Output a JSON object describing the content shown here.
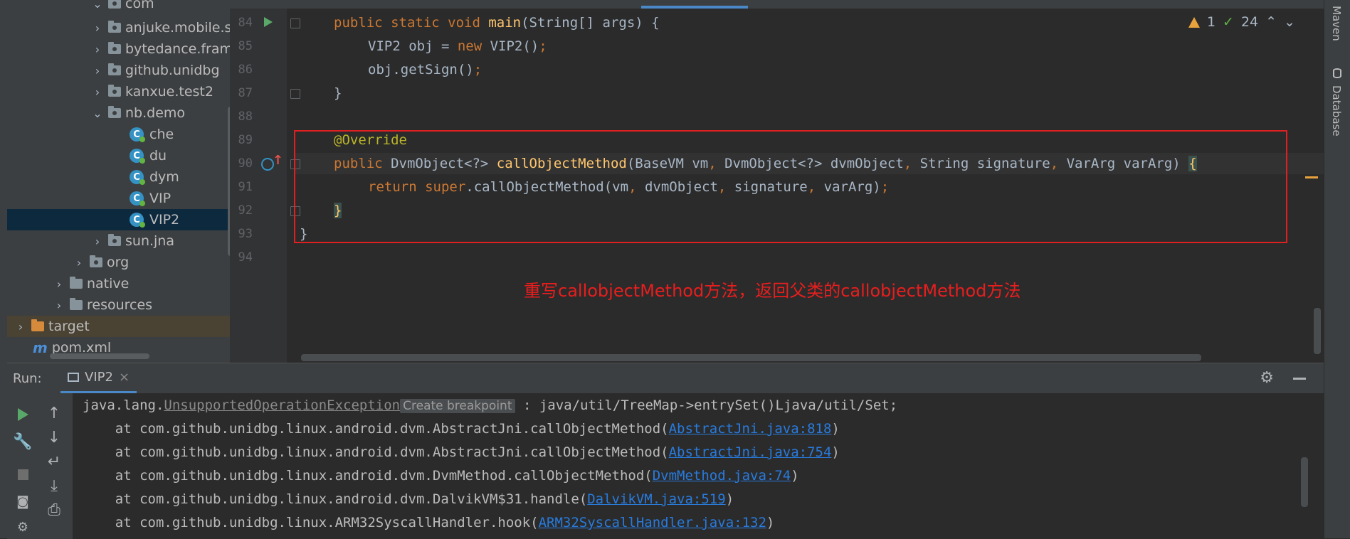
{
  "project_tree": {
    "items": [
      {
        "label": "com",
        "kind": "package"
      },
      {
        "label": "anjuke.mobile.si",
        "kind": "package"
      },
      {
        "label": "bytedance.frame",
        "kind": "package"
      },
      {
        "label": "github.unidbg",
        "kind": "package"
      },
      {
        "label": "kanxue.test2",
        "kind": "package"
      },
      {
        "label": "nb.demo",
        "kind": "package-open"
      },
      {
        "label": "che",
        "kind": "class"
      },
      {
        "label": "du",
        "kind": "class"
      },
      {
        "label": "dym",
        "kind": "class"
      },
      {
        "label": "VIP",
        "kind": "class"
      },
      {
        "label": "VIP2",
        "kind": "class-selected"
      },
      {
        "label": "sun.jna",
        "kind": "package"
      },
      {
        "label": "org",
        "kind": "package"
      },
      {
        "label": "native",
        "kind": "folder"
      },
      {
        "label": "resources",
        "kind": "resources-folder"
      },
      {
        "label": "target",
        "kind": "excluded-folder"
      },
      {
        "label": "pom.xml",
        "kind": "maven-file"
      }
    ]
  },
  "editor": {
    "line_numbers": [
      "84",
      "85",
      "86",
      "87",
      "88",
      "89",
      "90",
      "91",
      "92",
      "93",
      "94"
    ],
    "lines": {
      "l84": {
        "kw1": "public static void ",
        "fn": "main",
        "rest": "(String[] args) {"
      },
      "l85": {
        "a": "VIP2 obj = ",
        "kw": "new ",
        "b": "VIP2()",
        "semi": ";"
      },
      "l86": {
        "a": "obj.getSign()",
        "semi": ";"
      },
      "l87": {
        "a": "}"
      },
      "l89": {
        "ann": "@Override"
      },
      "l90": {
        "kw1": "public ",
        "t1": "DvmObject<?> ",
        "fn": "callObjectMethod",
        "p1": "(BaseVM vm",
        "c1": ", ",
        "p2": "DvmObject<?> dvmObject",
        "c2": ", ",
        "p3": "String signature",
        "c3": ", ",
        "p4": "VarArg varArg) ",
        "brace": "{"
      },
      "l91": {
        "kw1": "return ",
        "kw2": "super",
        "a": ".callObjectMethod(vm",
        "c1": ", ",
        "b": "dvmObject",
        "c2": ", ",
        "c": "signature",
        "c3": ", ",
        "d": "varArg)",
        "semi": ";"
      },
      "l92": {
        "a": "}"
      },
      "l93": {
        "a": "}"
      }
    },
    "inspections": {
      "warnings": "1",
      "weak_warnings": "24"
    },
    "annotation_text": "重写callobjectMethod方法，返回父类的callobjectMethod方法"
  },
  "right_tools": {
    "maven": "Maven",
    "database": "Database"
  },
  "run_panel": {
    "label": "Run:",
    "tab_label": "VIP2",
    "console": {
      "line1": {
        "pre": "java.lang.",
        "exc": "UnsupportedOperationException",
        "hint": "Create breakpoint",
        "post": " : java/util/TreeMap->entrySet()Ljava/util/Set;"
      },
      "frames": [
        {
          "text": "    at com.github.unidbg.linux.android.dvm.AbstractJni.callObjectMethod(",
          "link": "AbstractJni.java:818",
          "end": ")"
        },
        {
          "text": "    at com.github.unidbg.linux.android.dvm.AbstractJni.callObjectMethod(",
          "link": "AbstractJni.java:754",
          "end": ")"
        },
        {
          "text": "    at com.github.unidbg.linux.android.dvm.DvmMethod.callObjectMethod(",
          "link": "DvmMethod.java:74",
          "end": ")"
        },
        {
          "text": "    at com.github.unidbg.linux.android.dvm.DalvikVM$31.handle(",
          "link": "DalvikVM.java:519",
          "end": ")"
        },
        {
          "text": "    at com.github.unidbg.linux.ARM32SyscallHandler.hook(",
          "link": "ARM32SyscallHandler.java:132",
          "end": ")"
        }
      ]
    }
  },
  "colors": {
    "keyword": "#cc7832",
    "function": "#ffc66d",
    "annotation": "#bbb529",
    "highlight_box": "#e02020",
    "link": "#287bde"
  }
}
